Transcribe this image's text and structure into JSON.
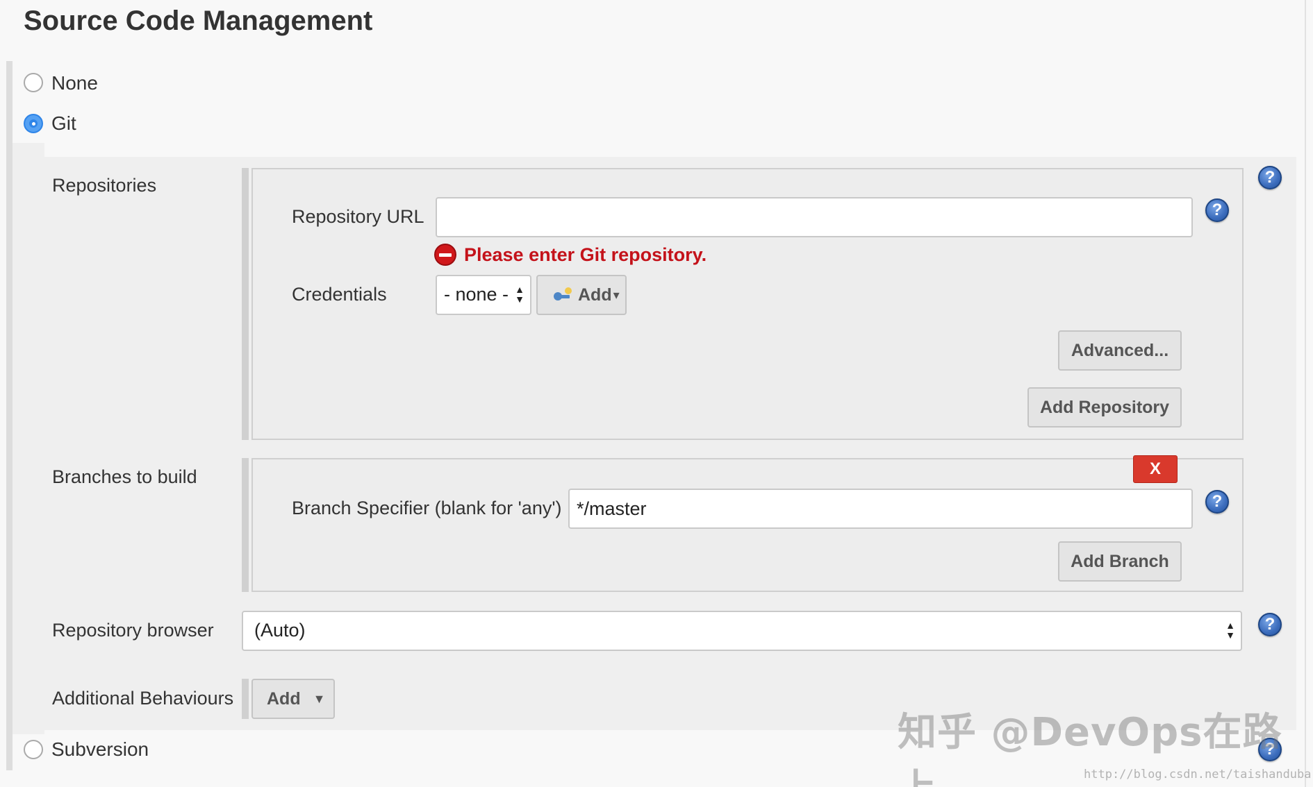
{
  "section_title": "Source Code Management",
  "scm_options": {
    "none": "None",
    "git": "Git",
    "subversion": "Subversion"
  },
  "selected_scm": "Git",
  "repositories": {
    "label": "Repositories",
    "url_label": "Repository URL",
    "url_value": "",
    "url_error": "Please enter Git repository.",
    "credentials_label": "Credentials",
    "credentials_selected": "- none -",
    "credentials_add_button": "Add",
    "advanced_button": "Advanced...",
    "add_repository_button": "Add Repository"
  },
  "branches": {
    "label": "Branches to build",
    "remove_button": "X",
    "specifier_label": "Branch Specifier (blank for 'any')",
    "specifier_value": "*/master",
    "add_branch_button": "Add Branch"
  },
  "repository_browser": {
    "label": "Repository browser",
    "selected": "(Auto)"
  },
  "additional_behaviours": {
    "label": "Additional Behaviours",
    "add_button": "Add"
  },
  "help_glyph": "?",
  "watermark": {
    "text": "知乎 @DevOps在路上",
    "url": "http://blog.csdn.net/taishanduba"
  },
  "colors": {
    "error": "#c4121a",
    "radio_checked": "#2f85e8",
    "remove_button": "#d9392c",
    "help_icon": "#3b6cbc"
  }
}
